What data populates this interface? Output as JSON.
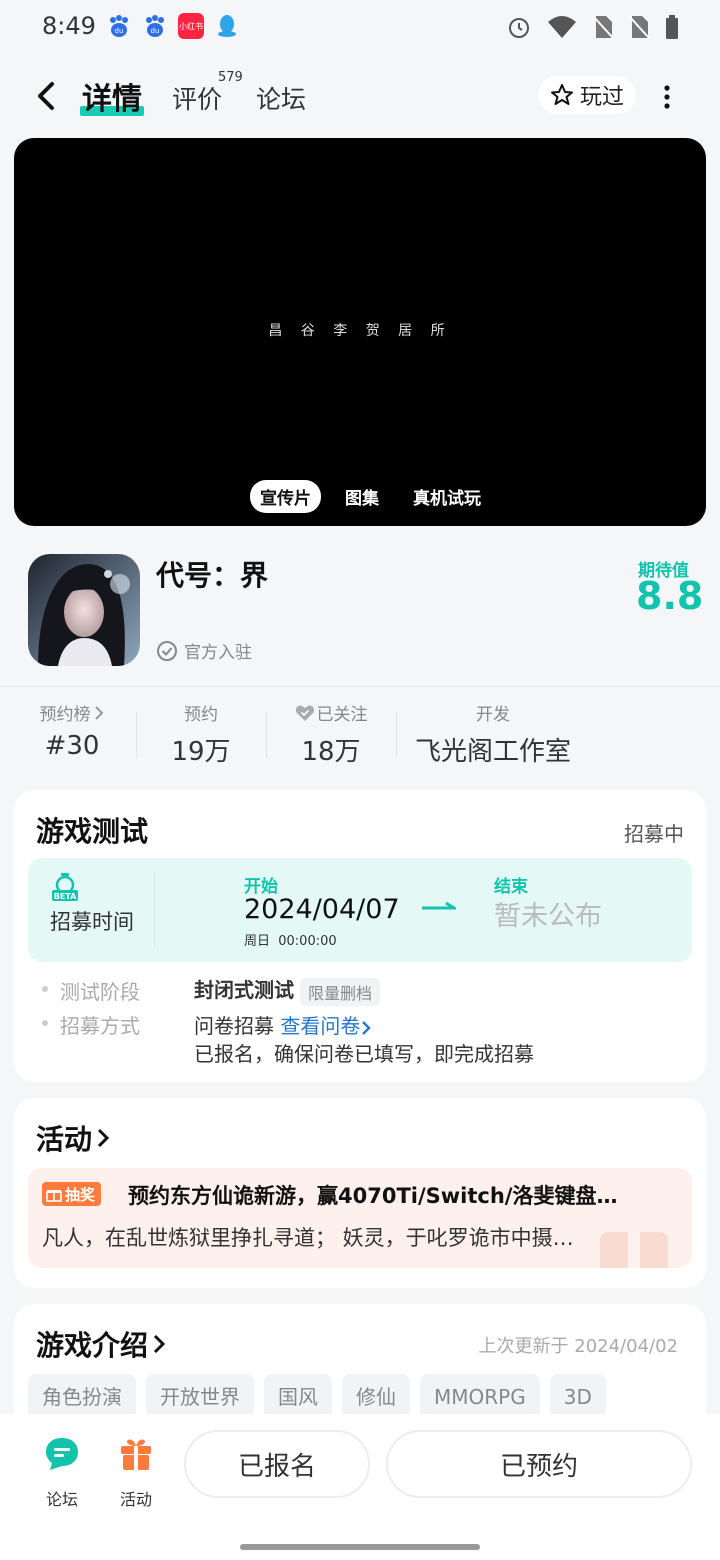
{
  "status": {
    "time": "8:49",
    "notification_badge": "小红书"
  },
  "nav": {
    "tabs": [
      {
        "label": "详情",
        "active": true
      },
      {
        "label": "评价",
        "badge": "579"
      },
      {
        "label": "论坛"
      }
    ],
    "played_label": "玩过"
  },
  "video": {
    "caption": "昌 谷 李 贺 居 所",
    "media_tabs": [
      "宣传片",
      "图集",
      "真机试玩"
    ]
  },
  "game": {
    "title": "代号：界",
    "official": "官方入驻",
    "expect_label": "期待值",
    "expect_value": "8.8"
  },
  "stats": [
    {
      "label": "预约榜",
      "value": "#30",
      "has_chevron": true
    },
    {
      "label": "预约",
      "value": "19万"
    },
    {
      "label": "已关注",
      "value": "18万",
      "has_heart": true
    },
    {
      "label": "开发",
      "value": "飞光阁工作室"
    }
  ],
  "test": {
    "title": "游戏测试",
    "status": "招募中",
    "recruit_icon_text": "BETA",
    "recruit_label": "招募时间",
    "start_label": "开始",
    "start_date": "2024/04/07",
    "start_sub": "周日  00:00:00",
    "end_label": "结束",
    "end_value": "暂未公布",
    "rows": [
      {
        "label": "测试阶段",
        "value": "封闭式测试",
        "tag": "限量删档"
      },
      {
        "label": "招募方式",
        "value": "问卷招募",
        "link": "查看问卷",
        "note": "已报名，确保问卷已填写，即完成招募"
      }
    ]
  },
  "activity": {
    "title": "活动",
    "badge": "抽奖",
    "headline": "预约东方仙诡新游，赢4070Ti/Switch/洛斐键盘…",
    "desc": "凡人，在乱世炼狱里挣扎寻道；  妖灵，于叱罗诡市中摄…"
  },
  "intro": {
    "title": "游戏介绍",
    "updated": "上次更新于 2024/04/02",
    "tags": [
      "角色扮演",
      "开放世界",
      "国风",
      "修仙",
      "MMORPG",
      "3D"
    ]
  },
  "bottom": {
    "forum_label": "论坛",
    "activity_label": "活动",
    "registered_label": "已报名",
    "reserved_label": "已预约"
  },
  "colors": {
    "accent": "#12c4ad",
    "orange": "#ff7a3d",
    "link": "#2478c9"
  }
}
